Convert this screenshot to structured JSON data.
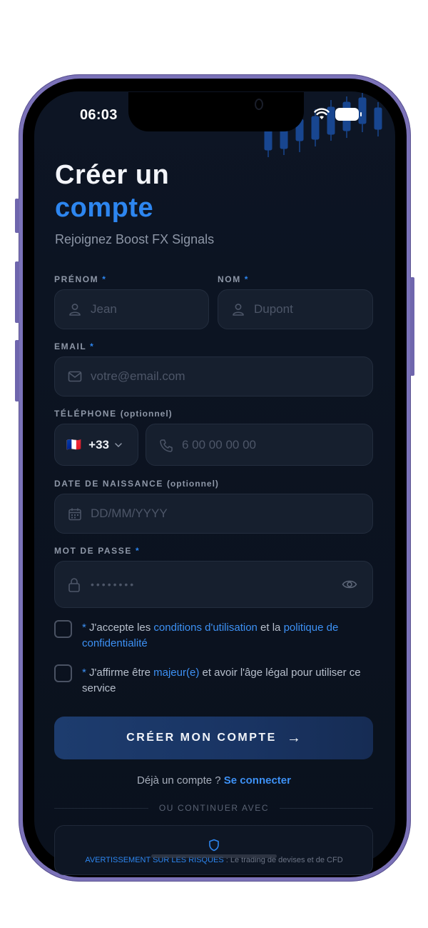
{
  "status_bar": {
    "time": "06:03"
  },
  "header": {
    "title_line1": "Créer un",
    "title_line2": "compte",
    "subtitle": "Rejoignez Boost FX Signals"
  },
  "form": {
    "first_name": {
      "label": "PRÉNOM",
      "required": "*",
      "placeholder": "Jean"
    },
    "last_name": {
      "label": "NOM",
      "required": "*",
      "placeholder": "Dupont"
    },
    "email": {
      "label": "EMAIL",
      "required": "*",
      "placeholder": "votre@email.com"
    },
    "phone": {
      "label": "TÉLÉPHONE",
      "optional": "(optionnel)",
      "country_flag": "🇫🇷",
      "country_code": "+33",
      "placeholder": "6 00 00 00 00"
    },
    "birthdate": {
      "label": "DATE DE NAISSANCE",
      "optional": "(optionnel)",
      "placeholder": "DD/MM/YYYY"
    },
    "password": {
      "label": "MOT DE PASSE",
      "required": "*",
      "value": "••••••••"
    }
  },
  "consents": {
    "terms": {
      "star": "*",
      "text_a": " J'accepte les ",
      "link_a": "conditions d'utilisation",
      "text_b": " et la ",
      "link_b": "politique de confidentialité",
      "checked": false
    },
    "age": {
      "star": "*",
      "text_a": " J'affirme être ",
      "link_a": "majeur(e)",
      "text_b": " et avoir l'âge légal pour utiliser ce service",
      "checked": false
    }
  },
  "cta": {
    "label": "CRÉER MON COMPTE",
    "arrow": "→"
  },
  "login": {
    "prompt": "Déjà un compte ? ",
    "link": "Se connecter"
  },
  "divider": {
    "text": "OU CONTINUER AVEC"
  },
  "risk_warning": {
    "label": "AVERTISSEMENT SUR LES RISQUES",
    "text": " : Le trading de devises et de CFD"
  },
  "colors": {
    "accent": "#2d86f0",
    "background": "#0b1220",
    "field": "#161f2e"
  },
  "icons": [
    "user-icon",
    "mail-icon",
    "phone-icon",
    "calendar-icon",
    "lock-icon",
    "eye-icon",
    "chevron-down-icon",
    "arrow-right-icon",
    "shield-icon",
    "wifi-icon",
    "battery-icon"
  ]
}
